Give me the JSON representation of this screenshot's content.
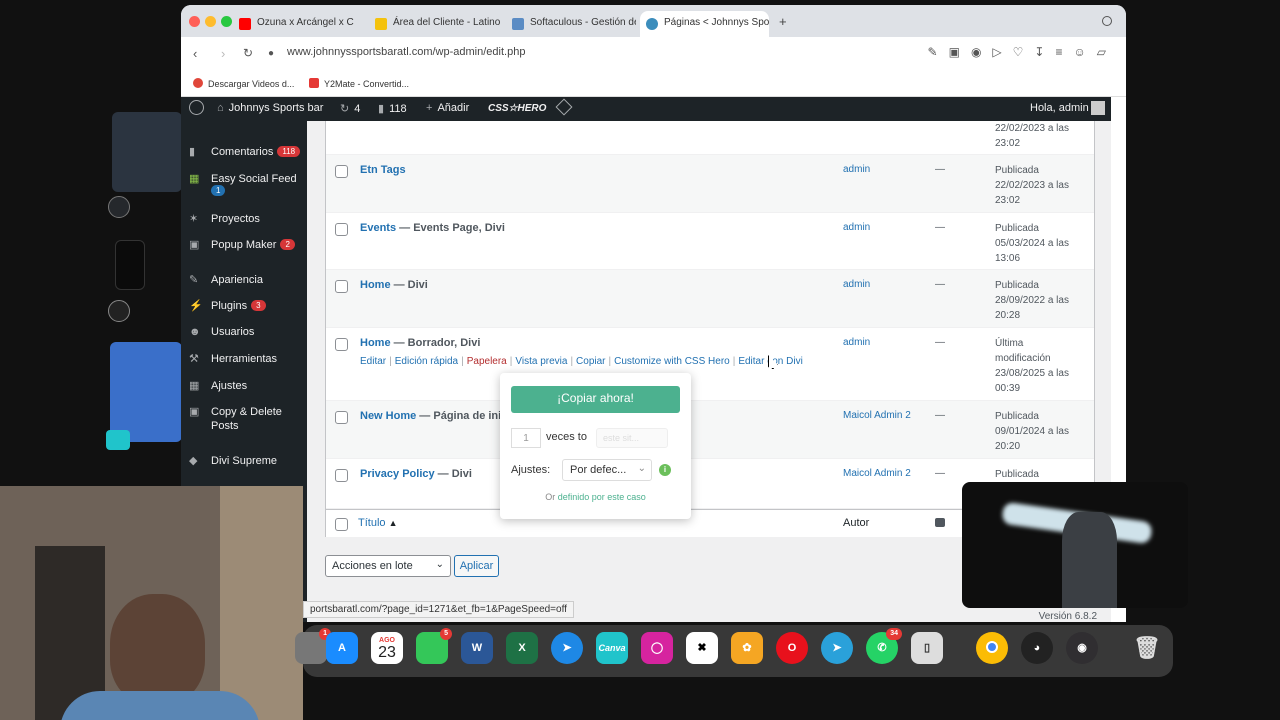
{
  "browser": {
    "tabs": [
      {
        "label": "Ozuna x Arcángel x C",
        "color": "#ff0000"
      },
      {
        "label": "Área del Cliente - Latino",
        "color": "#f4c20d"
      },
      {
        "label": "Softaculous - Gestión de",
        "color": "#5b8cc4"
      },
      {
        "label": "Páginas < Johnnys Spor",
        "color": "#3c8dbc"
      }
    ],
    "new_tab": "+",
    "url": "www.johnnyssportsbaratl.com/wp-admin/edit.php",
    "bookmarks": [
      {
        "label": "Descargar Videos d...",
        "color": "#e0463a"
      },
      {
        "label": "Y2Mate - Convertid...",
        "color": "#e53935"
      }
    ]
  },
  "adminbar": {
    "site": "Johnnys Sports bar",
    "updates": "4",
    "comments": "118",
    "add": "Añadir",
    "css_hero": "CSS☆HERO",
    "greeting": "Hola, admin"
  },
  "sidebar": {
    "items": [
      {
        "label": "Comentarios",
        "badge": "118"
      },
      {
        "label": "Easy Social Feed",
        "badge": "1"
      },
      {
        "label": "Proyectos"
      },
      {
        "label": "Popup Maker",
        "badge": "2"
      },
      {
        "label": "Apariencia"
      },
      {
        "label": "Plugins",
        "badge": "3"
      },
      {
        "label": "Usuarios"
      },
      {
        "label": "Herramientas"
      },
      {
        "label": "Ajustes"
      },
      {
        "label": "Copy & Delete Posts"
      },
      {
        "label": "Divi Supreme"
      }
    ]
  },
  "pages": {
    "top_date": "22/02/2023 a las",
    "top_time": "23:02",
    "rows": [
      {
        "title": "Etn Tags",
        "state": "",
        "author": "admin",
        "dash": "—",
        "status": "Publicada",
        "date": "22/02/2023 a las",
        "time": "23:02"
      },
      {
        "title": "Events",
        "state": " — Events Page, Divi",
        "author": "admin",
        "dash": "—",
        "status": "Publicada",
        "date": "05/03/2024 a las",
        "time": "13:06"
      },
      {
        "title": "Home",
        "state": " — Divi",
        "author": "admin",
        "dash": "—",
        "status": "Publicada",
        "date": "28/09/2022 a las",
        "time": "20:28"
      },
      {
        "title": "Home",
        "state": " — Borrador, Divi",
        "author": "admin",
        "dash": "—",
        "status": "Última",
        "date": "modificación",
        "time": "23/08/2025 a las",
        "time2": "00:39"
      },
      {
        "title": "New Home",
        "state": " — Página de inic",
        "author": "Maicol Admin 2",
        "dash": "—",
        "status": "Publicada",
        "date": "09/01/2024 a las",
        "time": "20:20"
      },
      {
        "title": "Privacy Policy",
        "state": " — Divi",
        "author": "Maicol Admin 2",
        "dash": "—",
        "status": "Publicada",
        "date": "",
        "time": ""
      }
    ],
    "row_actions": {
      "edit": "Editar",
      "quick": "Edición rápida",
      "trash": "Papelera",
      "preview": "Vista previa",
      "copy": "Copiar",
      "css_hero": "Customize with CSS Hero",
      "divi": "Editar con Divi"
    },
    "footer": {
      "title": "Título",
      "author": "Autor"
    },
    "bulk": "Acciones en lote",
    "apply": "Aplicar",
    "version": "Versión 6.8.2",
    "status_url": "portsbaratl.com/?page_id=1271&et_fb=1&PageSpeed=off"
  },
  "popup": {
    "button": "¡Copiar ahora!",
    "count": "1",
    "times_to": "veces to",
    "dest": "este sit...",
    "settings_label": "Ajustes:",
    "settings_value": "Por defec...",
    "or": "Or",
    "link": "definido por este caso"
  },
  "dock": {
    "calendar_month": "AGO",
    "calendar_day": "23",
    "badges": {
      "settings": "1",
      "facetime": "5",
      "whatsapp": "34"
    },
    "apps": [
      "App Store",
      "Calendar",
      "FaceTime",
      "Word",
      "Excel",
      "Safari",
      "Canva",
      "Instagram",
      "CapCut",
      "Photos",
      "Opera",
      "Telegram",
      "WhatsApp",
      "Phone",
      "Chrome",
      "Speed",
      "OBS",
      "Trash"
    ]
  }
}
